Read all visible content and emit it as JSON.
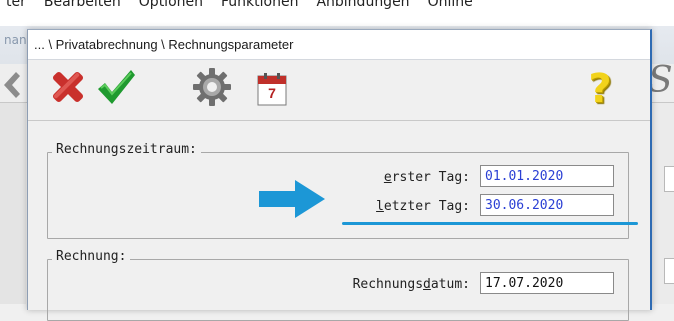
{
  "background_app": {
    "menu_items": [
      "ter",
      "Bearbeiten",
      "Optionen",
      "Funktionen",
      "Anbindungen",
      "Online"
    ],
    "window_title_fragment": "nan",
    "right_glyph": "S"
  },
  "dialog": {
    "title": "... \\ Privatabrechnung \\ Rechnungsparameter",
    "toolbar": {
      "cancel_icon": "red-x-icon",
      "ok_icon": "green-check-icon",
      "settings_icon": "gear-icon",
      "calendar_icon": "calendar-icon",
      "calendar_day": "7",
      "help_icon": "yellow-question-icon",
      "help_glyph": "?"
    },
    "rechnungszeitraum": {
      "label": "Rechnungszeitraum:",
      "erster_tag": {
        "label_accel": "e",
        "label_rest": "rster Tag:",
        "value": "01.01.2020"
      },
      "letzter_tag": {
        "label_accel": "l",
        "label_rest": "etzter Tag:",
        "value": "30.06.2020"
      }
    },
    "rechnung": {
      "label": "Rechnung:",
      "rechnungsdatum": {
        "label_pre": "Rechnungs",
        "label_accel": "d",
        "label_post": "atum:",
        "value": "17.07.2020"
      }
    }
  },
  "colors": {
    "annotation_blue": "#1c97d6",
    "value_blue": "#2a3fd4"
  }
}
